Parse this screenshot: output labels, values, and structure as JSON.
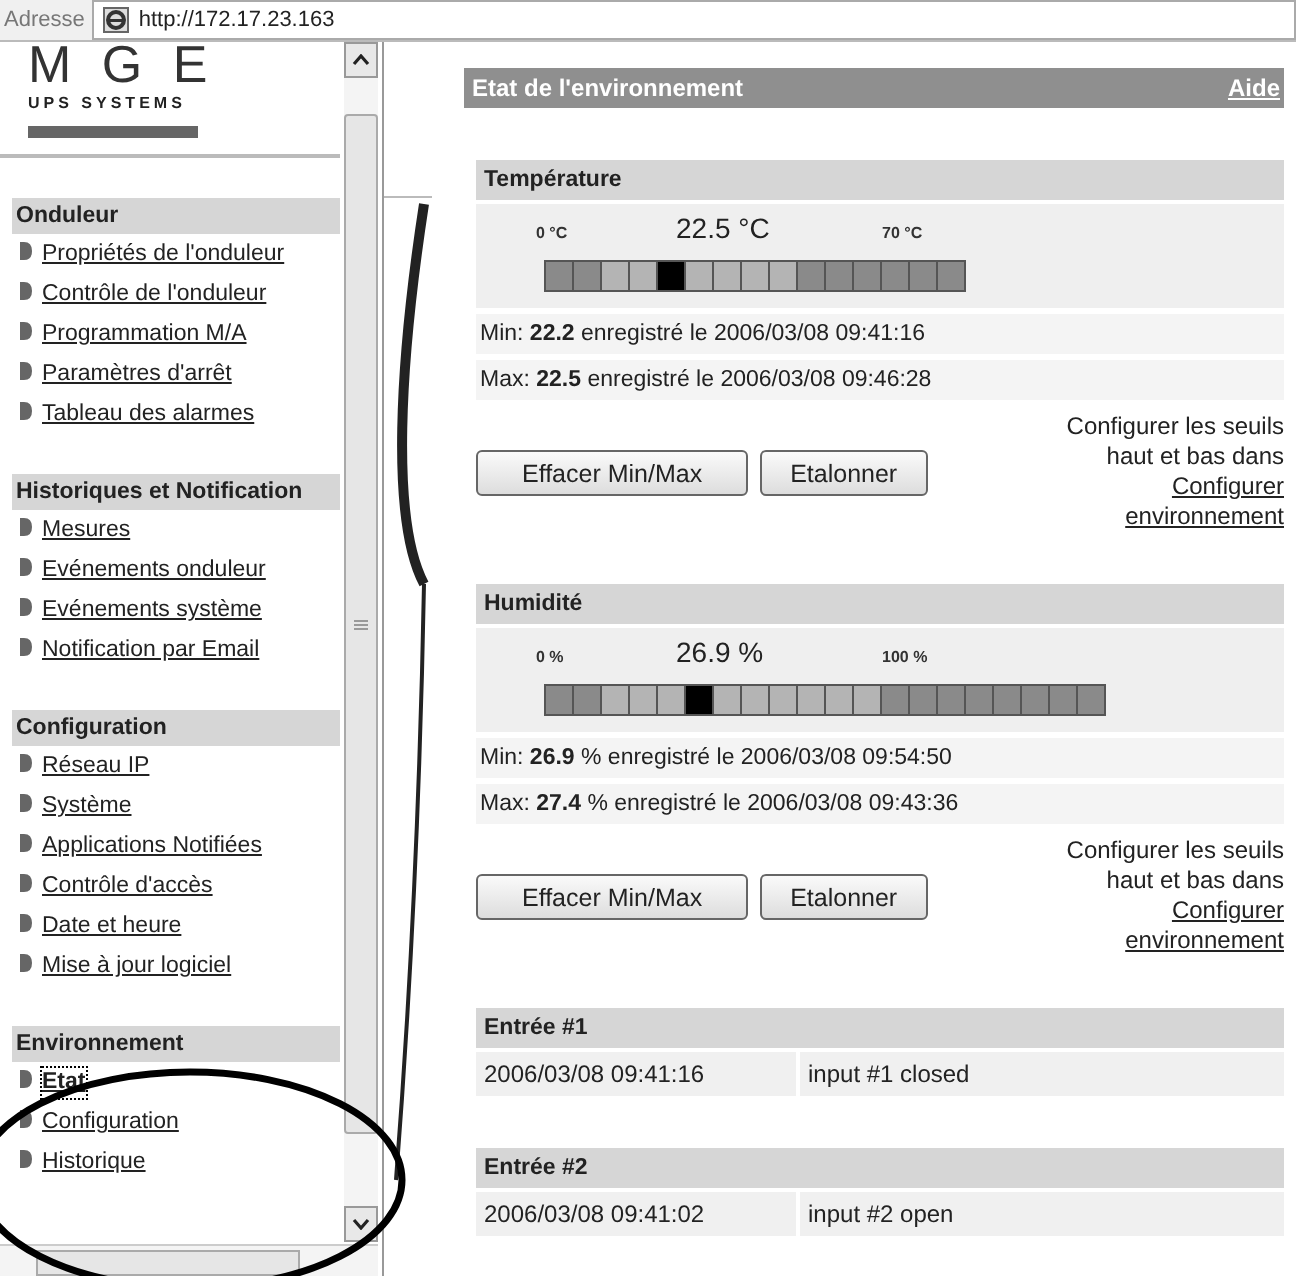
{
  "address_bar": {
    "label": "Adresse",
    "url": "http://172.17.23.163"
  },
  "sidebar": {
    "logo": {
      "name": "M G E",
      "tagline": "UPS SYSTEMS"
    },
    "sections": [
      {
        "title": "Onduleur",
        "items": [
          {
            "label": "Propriétés de l'onduleur",
            "selected": false
          },
          {
            "label": "Contrôle de l'onduleur",
            "selected": false
          },
          {
            "label": "Programmation M/A",
            "selected": false
          },
          {
            "label": "Paramètres d'arrêt",
            "selected": false
          },
          {
            "label": "Tableau des alarmes",
            "selected": false
          }
        ]
      },
      {
        "title": "Historiques et Notification",
        "items": [
          {
            "label": "Mesures",
            "selected": false
          },
          {
            "label": "Evénements onduleur",
            "selected": false
          },
          {
            "label": "Evénements système",
            "selected": false
          },
          {
            "label": "Notification par Email",
            "selected": false
          }
        ]
      },
      {
        "title": "Configuration",
        "items": [
          {
            "label": "Réseau IP",
            "selected": false
          },
          {
            "label": "Système",
            "selected": false
          },
          {
            "label": "Applications Notifiées",
            "selected": false
          },
          {
            "label": "Contrôle d'accès",
            "selected": false
          },
          {
            "label": "Date et heure",
            "selected": false
          },
          {
            "label": "Mise à jour logiciel",
            "selected": false
          }
        ]
      },
      {
        "title": "Environnement",
        "items": [
          {
            "label": "Etat",
            "selected": true
          },
          {
            "label": "Configuration",
            "selected": false
          },
          {
            "label": "Historique",
            "selected": false
          }
        ]
      }
    ]
  },
  "content": {
    "title": "Etat de l'environnement",
    "help": "Aide",
    "sensors": [
      {
        "kind": "temperature",
        "title": "Température",
        "scale_min": "0 °C",
        "reading": "22.5 °C",
        "scale_max": "70 °C",
        "level": 0.32,
        "min": "Min: **22.2**  enregistré le 2006/03/08 09:41:16",
        "max": "Max: **22.5**  enregistré le 2006/03/08 09:46:28",
        "buttons": [
          "Effacer Min/Max",
          "Etalonner"
        ],
        "note": "Configurer les seuils haut et bas dans",
        "link": "Configurer environnement"
      },
      {
        "kind": "humidity",
        "title": "Humidité",
        "scale_min": "0 %",
        "reading": "26.9 %",
        "scale_max": "100 %",
        "level": 0.269,
        "min": "Min: **26.9** %  enregistré le 2006/03/08 09:54:50",
        "max": "Max: **27.4** %  enregistré le 2006/03/08 09:43:36",
        "buttons": [
          "Effacer Min/Max",
          "Etalonner"
        ],
        "note": "Configurer les seuils haut et bas dans",
        "link": "Configurer environnement"
      }
    ],
    "inputs": [
      {
        "title": "Entrée #1",
        "time": "2006/03/08 09:41:16",
        "status": "input #1 closed"
      },
      {
        "title": "Entrée #2",
        "time": "2006/03/08 09:41:02",
        "status": "input #2 open"
      }
    ]
  }
}
